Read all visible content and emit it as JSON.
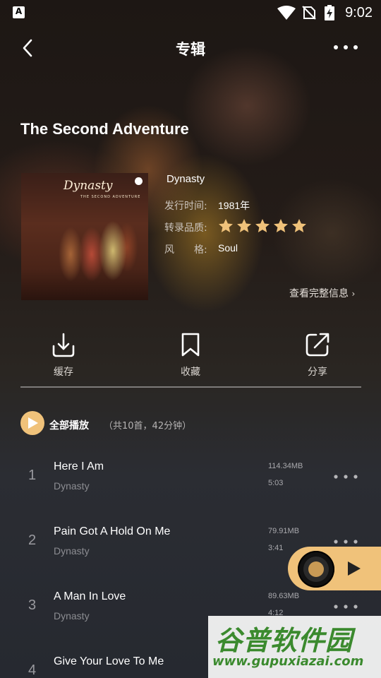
{
  "status_bar": {
    "time": "9:02",
    "app_icon_label": "A"
  },
  "nav": {
    "title": "专辑"
  },
  "album": {
    "title": "The Second Adventure",
    "cover_logo": "Dynasty",
    "cover_subtitle": "THE SECOND ADVENTURE",
    "artist": "Dynasty",
    "release_label": "发行时间:",
    "release_value": "1981年",
    "quality_label": "转录品质:",
    "quality_stars": 5,
    "quality_star_color": "#f0c27a",
    "genre_label": "风　　格:",
    "genre_value": "Soul",
    "full_info_link": "查看完整信息"
  },
  "actions": [
    {
      "label": "缓存",
      "icon": "download-icon"
    },
    {
      "label": "收藏",
      "icon": "bookmark-icon"
    },
    {
      "label": "分享",
      "icon": "share-icon"
    }
  ],
  "play_all": {
    "label": "全部播放",
    "count": "（共10首，42分钟）"
  },
  "tracks": [
    {
      "num": "1",
      "name": "Here I Am",
      "artist": "Dynasty",
      "size": "114.34MB",
      "duration": "5:03"
    },
    {
      "num": "2",
      "name": "Pain Got A Hold On Me",
      "artist": "Dynasty",
      "size": "79.91MB",
      "duration": "3:41"
    },
    {
      "num": "3",
      "name": "A Man In Love",
      "artist": "Dynasty",
      "size": "89.63MB",
      "duration": "4:12"
    },
    {
      "num": "4",
      "name": "Give Your Love To Me",
      "artist": "",
      "size": "",
      "duration": ""
    }
  ],
  "colors": {
    "accent": "#f0c27a",
    "watermark_green": "#3b8a2e"
  },
  "watermark": {
    "line1": "谷普软件园",
    "line2": "www.gupuxiazai.com"
  }
}
